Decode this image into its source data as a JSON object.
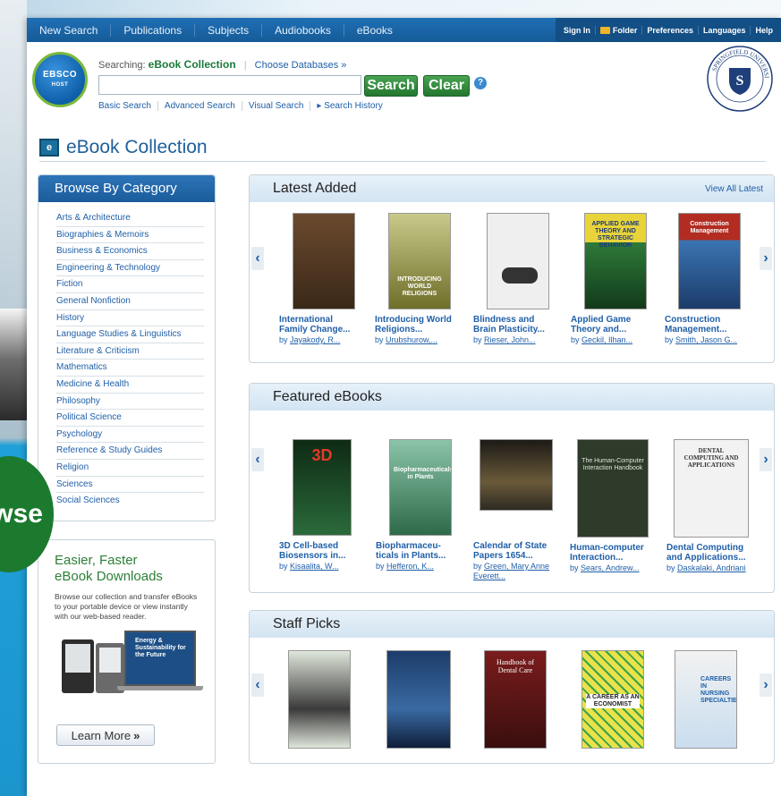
{
  "background": {
    "browse_bubble_text": "wse"
  },
  "topnav": {
    "items": [
      "New Search",
      "Publications",
      "Subjects",
      "Audiobooks",
      "eBooks"
    ],
    "right": [
      "Sign In",
      "Folder",
      "Preferences",
      "Languages",
      "Help"
    ]
  },
  "search": {
    "searching_label": "Searching:",
    "database": "eBook Collection",
    "choose_databases": "Choose Databases »",
    "input_value": "",
    "search_button": "Search",
    "clear_button": "Clear",
    "help": "?",
    "links": [
      "Basic Search",
      "Advanced Search",
      "Visual Search",
      "▸ Search History"
    ]
  },
  "logo": {
    "line1": "EBSCO",
    "line2": "HOST"
  },
  "page_title": "eBook Collection",
  "sidebar": {
    "browse_title": "Browse By Category",
    "categories": [
      "Arts & Architecture",
      "Biographies & Memoirs",
      "Business & Economics",
      "Engineering & Technology",
      "Fiction",
      "General Nonfiction",
      "History",
      "Language Studies & Linguistics",
      "Literature & Criticism",
      "Mathematics",
      "Medicine & Health",
      "Philosophy",
      "Political Science",
      "Psychology",
      "Reference & Study Guides",
      "Religion",
      "Sciences",
      "Social Sciences"
    ],
    "promo": {
      "title_line1": "Easier, Faster",
      "title_line2": "eBook Downloads",
      "description": "Browse our collection and transfer eBooks to your portable device or view instantly with our web-based reader.",
      "learn_more": "Learn More",
      "learn_more_arrow": "»",
      "promo_cover_text": "Energy & Sustainability for the Future"
    }
  },
  "sections": {
    "latest": {
      "title": "Latest Added",
      "view_all": "View All Latest",
      "books": [
        {
          "title": "International Family Change...",
          "author": "Jayakody, R...",
          "cover_color": "#6b4a2e"
        },
        {
          "title": "Introducing World Religions...",
          "author": "Urubshurow,...",
          "cover_color": "#8a8a3a"
        },
        {
          "title": "Blindness and Brain Plasticity...",
          "author": "Rieser, John...",
          "cover_color": "#efefef"
        },
        {
          "title": "Applied Game Theory and...",
          "author": "Geckil, Ilhan...",
          "cover_color": "#2e7a3a"
        },
        {
          "title": "Construction Management...",
          "author": "Smith, Jason G...",
          "cover_color": "#b22c22"
        }
      ]
    },
    "featured": {
      "title": "Featured eBooks",
      "books": [
        {
          "title": "3D Cell-based Biosensors in...",
          "author": "Kisaalita, W...",
          "cover_color": "#163c1f"
        },
        {
          "title": "Biopharmaceu- ticals in Plants...",
          "author": "Hefferon, K...",
          "cover_color": "#3a7a5a"
        },
        {
          "title": "Calendar of State Papers 1654...",
          "author": "Green, Mary Anne Everett...",
          "cover_color": "#4a3c2a"
        },
        {
          "title": "Human-computer Interaction...",
          "author": "Sears, Andrew...",
          "cover_color": "#2e3a2a"
        },
        {
          "title": "Dental Computing and Applications...",
          "author": "Daskalaki, Andriani",
          "cover_color": "#f2f2f2"
        }
      ]
    },
    "staff": {
      "title": "Staff Picks",
      "books": [
        {
          "cover_color": "#dfe6da"
        },
        {
          "cover_color": "#1c3c6a"
        },
        {
          "cover_color": "#7a1c1c"
        },
        {
          "cover_color": "#e9e24a"
        },
        {
          "cover_color": "#f2f2f2"
        }
      ]
    }
  },
  "cover_texts": {
    "latest_3": "APPLIED GAME THEORY AND STRATEGIC BEHAVIOR",
    "latest_4": "Construction Management",
    "latest_1": "INTRODUCING WORLD RELIGIONS",
    "featured_0": "3D",
    "featured_1": "Biopharmaceuticals in Plants",
    "featured_3": "The Human-Computer Interaction Handbook",
    "featured_4": "DENTAL COMPUTING AND APPLICATIONS",
    "staff_2": "Handbook of Dental Care",
    "staff_3": "A CAREER AS AN ECONOMIST",
    "staff_4": "CAREERS IN NURSING SPECIALTIES"
  },
  "colors": {
    "nav_blue": "#1f6fb5",
    "link_blue": "#1f5fa8",
    "green_button": "#2f8a3b",
    "section_head": "#dbe9f5"
  }
}
